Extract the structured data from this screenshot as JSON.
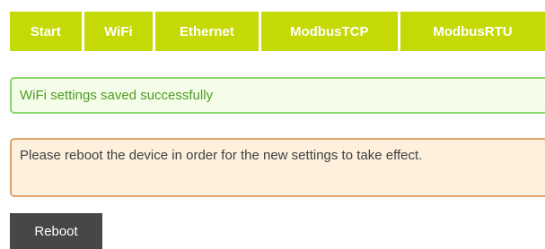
{
  "nav": {
    "tabs": [
      {
        "label": "Start"
      },
      {
        "label": "WiFi"
      },
      {
        "label": "Ethernet"
      },
      {
        "label": "ModbusTCP"
      },
      {
        "label": "ModbusRTU"
      }
    ]
  },
  "alerts": {
    "success": "WiFi settings saved successfully",
    "warning": "Please reboot the device in order for the new settings to take effect."
  },
  "actions": {
    "reboot_label": "Reboot"
  },
  "colors": {
    "nav_background": "#c5d904",
    "success_border": "#8cd66b",
    "success_text": "#4f9a22",
    "warning_border": "#dfa36a",
    "warning_background": "#fdf1de",
    "button_background": "#474747"
  }
}
